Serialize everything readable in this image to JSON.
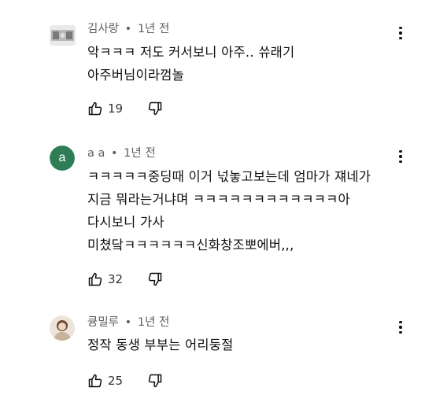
{
  "comments": [
    {
      "author": "김사랑",
      "separator": "•",
      "time": "1년 전",
      "avatar_type": "image",
      "lines": [
        "악ㅋㅋㅋ 저도 커서보니 아주.. 쓔래기",
        "아주버님이라껌놀"
      ],
      "likes": "19"
    },
    {
      "author": "a a",
      "separator": "•",
      "time": "1년 전",
      "avatar_type": "letter",
      "avatar_letter": "a",
      "avatar_color": "#2e7d57",
      "lines": [
        "ㅋㅋㅋㅋㅋ중딩때 이거 넋놓고보는데 엄마가 쟤네가",
        "지금 뭐라는거냐며 ㅋㅋㅋㅋㅋㅋㅋㅋㅋㅋㅋㅋ아",
        "다시보니 가사",
        "미쳤닼ㅋㅋㅋㅋㅋㅋ신화창조뽀에버,,,"
      ],
      "likes": "32"
    },
    {
      "author": "큥밀루",
      "separator": "•",
      "time": "1년 전",
      "avatar_type": "image",
      "lines": [
        "정작 동생 부부는 어리둥절"
      ],
      "likes": "25"
    }
  ],
  "icons": {
    "like": "thumb-up-outline-icon",
    "dislike": "thumb-down-outline-icon",
    "menu": "more-vertical-icon"
  }
}
